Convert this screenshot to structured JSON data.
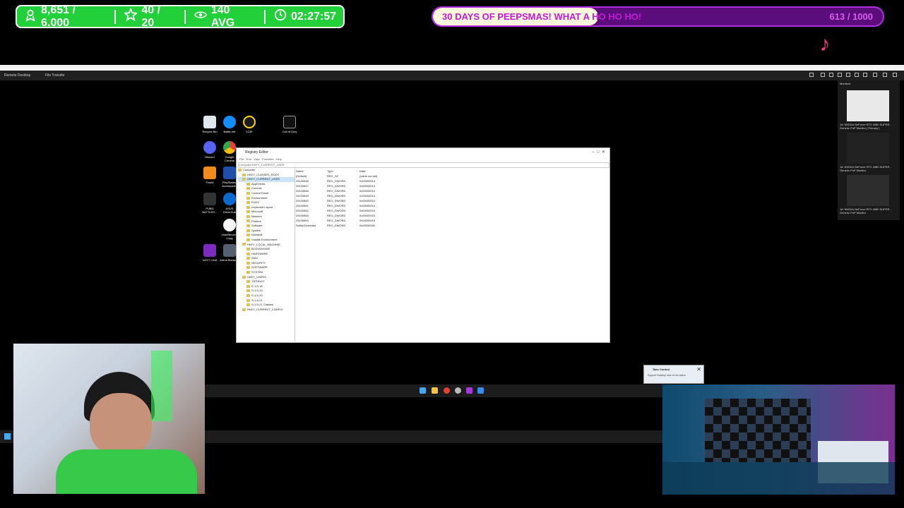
{
  "overlay": {
    "stats": {
      "followers": "8,651 / 6,000",
      "subs": "40 / 20",
      "viewers": "140 AVG",
      "timer": "02:27:57"
    },
    "goal": {
      "text": "30 DAYS OF PEEPSMAS! WHAT A HO HO HO!",
      "count": "613 / 1000",
      "progress": 0.613
    },
    "colors": {
      "stats_bg": "#22d03a",
      "goal_border": "#b52de0",
      "goal_fill": "#fff8dc",
      "goal_text": "#c21ad6"
    }
  },
  "remote_desktop": {
    "toolbar_tabs": [
      "Remote Desktop",
      "File Transfer"
    ]
  },
  "desktop_icons": [
    {
      "label": "Recycle Bin",
      "icon": "recycle-bin-icon"
    },
    {
      "label": "Battle.net",
      "icon": "battlenet-icon"
    },
    {
      "label": "iCUE",
      "icon": "icue-icon"
    },
    {
      "label": "Call of Duty",
      "icon": "call-of-duty-icon"
    },
    {
      "label": "Discord",
      "icon": "discord-icon"
    },
    {
      "label": "Google Chrome",
      "icon": "chrome-icon"
    },
    {
      "label": "FiveM",
      "icon": "fivem-icon"
    },
    {
      "label": "PlayStation Accessories",
      "icon": "playstation-icon"
    },
    {
      "label": "PUBG BATTLEG...",
      "icon": "pubg-icon"
    },
    {
      "label": "ASUS DriverHub",
      "icon": "asus-icon"
    },
    {
      "label": "UserBench - Copy",
      "icon": "userbench-icon"
    },
    {
      "label": "NZXT CAM",
      "icon": "nzxt-icon"
    },
    {
      "label": "Arena Breako...",
      "icon": "arena-icon"
    }
  ],
  "regedit": {
    "title": "Registry Editor",
    "menu": [
      "File",
      "Edit",
      "View",
      "Favorites",
      "Help"
    ],
    "address": "Computer\\HKEY_CURRENT_USER",
    "tree": [
      "Computer",
      "HKEY_CLASSES_ROOT",
      "HKEY_CURRENT_USER",
      "AppEvents",
      "Console",
      "Control Panel",
      "Environment",
      "EUDC",
      "Keyboard Layout",
      "Microsoft",
      "Network",
      "Printers",
      "Software",
      "System",
      "Uninstall",
      "Volatile Environment",
      "HKEY_LOCAL_MACHINE",
      "BCD00000000",
      "HARDWARE",
      "SAM",
      "SECURITY",
      "SOFTWARE",
      "SYSTEM",
      "HKEY_USERS",
      ".DEFAULT",
      "S-1-5-18",
      "S-1-5-19",
      "S-1-5-20",
      "S-1-5-21",
      "S-1-5-21 Classes",
      "HKEY_CURRENT_CONFIG"
    ],
    "columns": [
      "Name",
      "Type",
      "Data"
    ],
    "rows": [
      [
        "(Default)",
        "REG_SZ",
        "(value not set)"
      ],
      [
        "25100848",
        "REG_DWORD",
        "0x00000014"
      ],
      [
        "25100847",
        "REG_DWORD",
        "0x00000014"
      ],
      [
        "25100846",
        "REG_DWORD",
        "0x00000014"
      ],
      [
        "25100849",
        "REG_DWORD",
        "0x00000014"
      ],
      [
        "25100850",
        "REG_DWORD",
        "0x00000014"
      ],
      [
        "25100851",
        "REG_DWORD",
        "0x00000014"
      ],
      [
        "25100852",
        "REG_DWORD",
        "0x00000015"
      ],
      [
        "25100853",
        "REG_DWORD",
        "0x00000015"
      ],
      [
        "25100854",
        "REG_DWORD",
        "0x00000015"
      ],
      [
        "NotifyGenerator",
        "REG_DWORD",
        "0x00000000"
      ]
    ]
  },
  "monitors": {
    "title": "Monitors",
    "items": [
      "1#: NVIDIA GeForce RTX 4080 SUPER - Generic PnP Monitor [ Primary ]",
      "1#: NVIDIA GeForce RTX 4080 SUPER - Generic PnP Monitor",
      "1#: NVIDIA GeForce RTX 4080 SUPER - Generic PnP Monitor"
    ]
  },
  "toast": {
    "title": "Take Control",
    "body": "Support Desktop user is Not active"
  }
}
